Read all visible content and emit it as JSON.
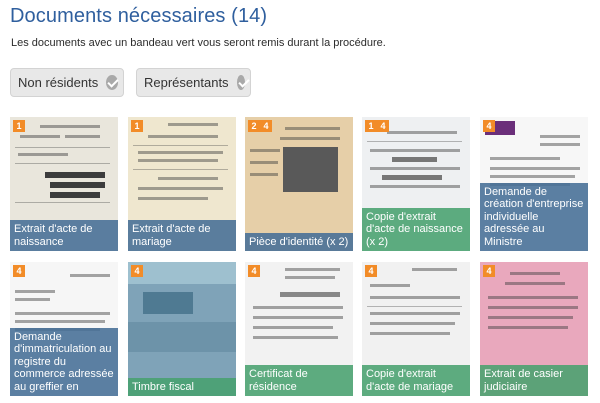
{
  "header": {
    "title": "Documents nécessaires (14)",
    "subtitle": "Les documents avec un bandeau vert vous seront remis durant la procédure."
  },
  "filters": [
    {
      "label": "Non résidents",
      "icon": "check-circle-icon"
    },
    {
      "label": "Représentants",
      "icon": "check-circle-icon"
    }
  ],
  "colors": {
    "title": "#2f5f9e",
    "badge": "#f28c28",
    "caption_blue": "#466e96",
    "caption_green": "#48a06e"
  },
  "documents": [
    {
      "badges": [
        "1"
      ],
      "caption": "Extrait d'acte de naissance",
      "banner": "blue"
    },
    {
      "badges": [
        "1"
      ],
      "caption": "Extrait d'acte de mariage",
      "banner": "blue"
    },
    {
      "badges": [
        "2",
        "4"
      ],
      "caption": "Pièce d'identité (x 2)",
      "banner": "blue"
    },
    {
      "badges": [
        "1",
        "4"
      ],
      "caption": "Copie d'extrait d'acte de naissance (x 2)",
      "banner": "green"
    },
    {
      "badges": [
        "4"
      ],
      "caption": "Demande de création d'entreprise individuelle adressée au Ministre",
      "banner": "blue"
    },
    {
      "badges": [
        "4"
      ],
      "caption": "Demande d'immatriculation au registre du commerce adressée au greffier en",
      "banner": "blue"
    },
    {
      "badges": [
        "4"
      ],
      "caption": "Timbre fiscal",
      "banner": "green"
    },
    {
      "badges": [
        "4"
      ],
      "caption": "Certificat de résidence",
      "banner": "green"
    },
    {
      "badges": [
        "4"
      ],
      "caption": "Copie d'extrait d'acte de mariage",
      "banner": "green"
    },
    {
      "badges": [
        "4"
      ],
      "caption": "Extrait de casier judiciaire",
      "banner": "green"
    }
  ]
}
